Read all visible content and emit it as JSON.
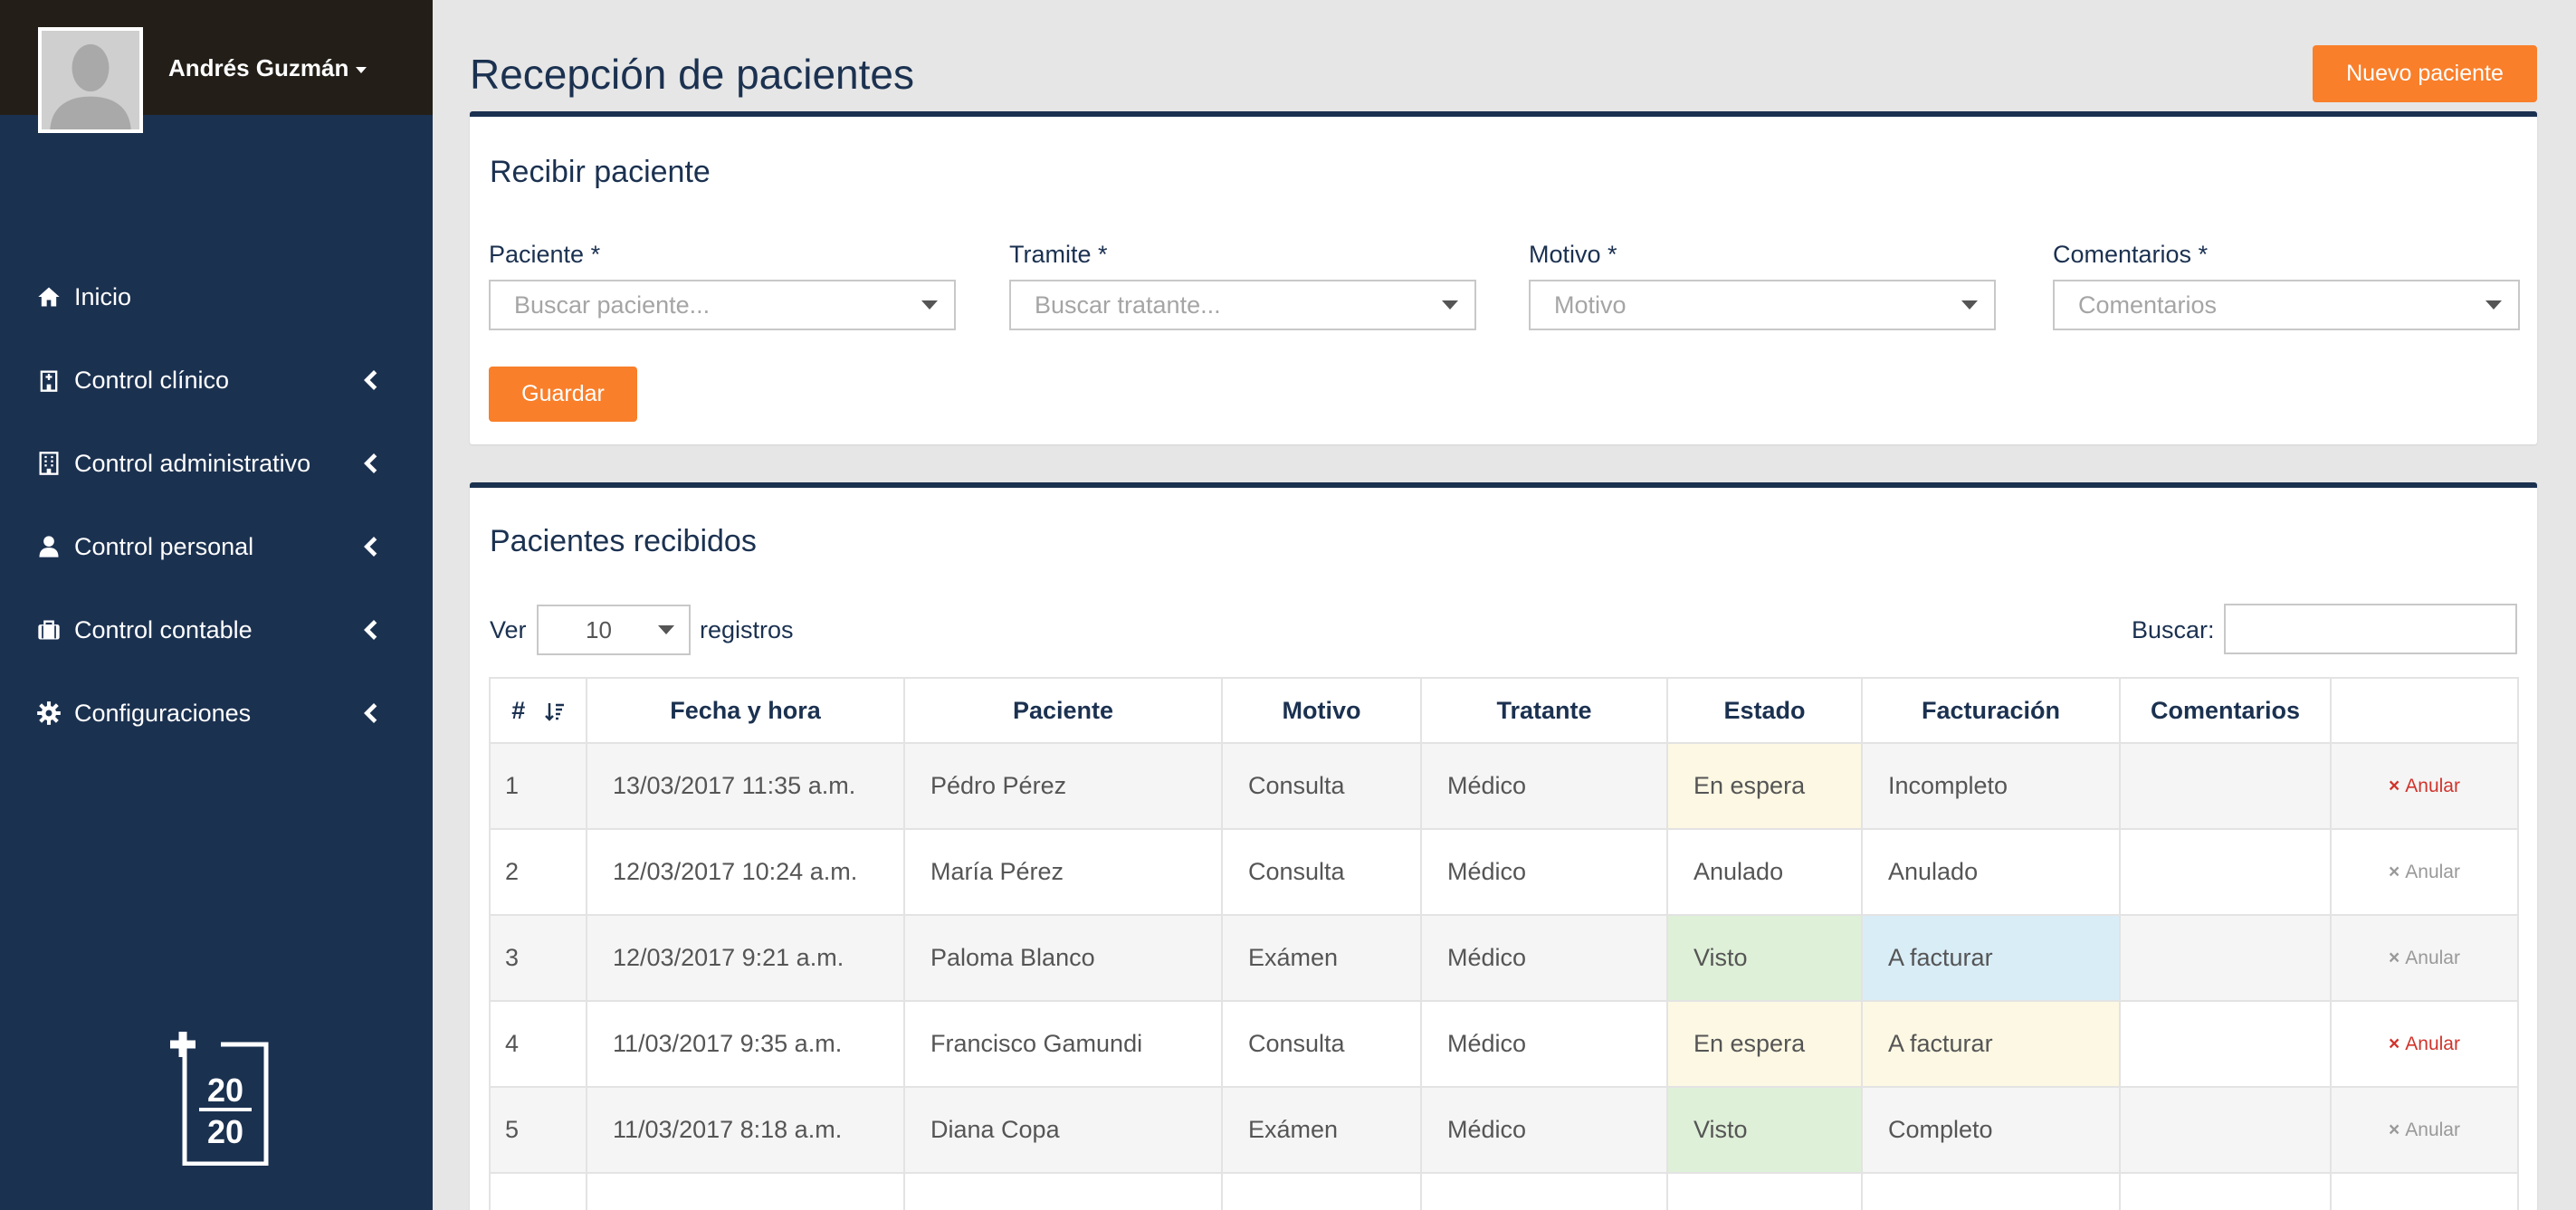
{
  "user": {
    "name": "Andrés Guzmán"
  },
  "sidebar": {
    "items": [
      {
        "label": "Inicio",
        "icon": "home-icon"
      },
      {
        "label": "Control clínico",
        "icon": "hospital-icon"
      },
      {
        "label": "Control administrativo",
        "icon": "building-icon"
      },
      {
        "label": "Control personal",
        "icon": "user-icon"
      },
      {
        "label": "Control contable",
        "icon": "briefcase-icon"
      },
      {
        "label": "Configuraciones",
        "icon": "gear-icon"
      }
    ],
    "logo_top": "20",
    "logo_bottom": "20"
  },
  "page": {
    "title": "Recepción de pacientes",
    "new_patient_button": "Nuevo paciente"
  },
  "form": {
    "title": "Recibir paciente",
    "fields": [
      {
        "label": "Paciente *",
        "placeholder": "Buscar paciente..."
      },
      {
        "label": "Tramite *",
        "placeholder": "Buscar tratante..."
      },
      {
        "label": "Motivo *",
        "placeholder": "Motivo"
      },
      {
        "label": "Comentarios *",
        "placeholder": "Comentarios"
      }
    ],
    "save_button": "Guardar"
  },
  "list": {
    "title": "Pacientes recibidos",
    "show_label": "Ver",
    "page_size": "10",
    "records_label": "registros",
    "search_label": "Buscar:",
    "search_value": "",
    "columns": [
      "#",
      "Fecha y hora",
      "Paciente",
      "Motivo",
      "Tratante",
      "Estado",
      "Facturación",
      "Comentarios",
      ""
    ],
    "rows": [
      {
        "num": "1",
        "datetime": "13/03/2017  11:35 a.m.",
        "patient": "Pédro Pérez",
        "reason": "Consulta",
        "doctor": "Médico",
        "status": "En espera",
        "billing": "Incompleto",
        "comments": "",
        "action": "Anular"
      },
      {
        "num": "2",
        "datetime": "12/03/2017  10:24 a.m.",
        "patient": "María Pérez",
        "reason": "Consulta",
        "doctor": "Médico",
        "status": "Anulado",
        "billing": "Anulado",
        "comments": "",
        "action": "Anular"
      },
      {
        "num": "3",
        "datetime": "12/03/2017  9:21 a.m.",
        "patient": "Paloma Blanco",
        "reason": "Exámen",
        "doctor": "Médico",
        "status": "Visto",
        "billing": "A facturar",
        "comments": "",
        "action": "Anular"
      },
      {
        "num": "4",
        "datetime": "11/03/2017  9:35 a.m.",
        "patient": "Francisco Gamundi",
        "reason": "Consulta",
        "doctor": "Médico",
        "status": "En espera",
        "billing": "A facturar",
        "comments": "",
        "action": "Anular"
      },
      {
        "num": "5",
        "datetime": "11/03/2017 8:18 a.m.",
        "patient": "Diana Copa",
        "reason": "Exámen",
        "doctor": "Médico",
        "status": "Visto",
        "billing": "Completo",
        "comments": "",
        "action": "Anular"
      }
    ]
  },
  "colors": {
    "sidebar": "#1b3150",
    "accent": "#f97f2a",
    "waiting": "#fcf8e3",
    "seen": "#dff0d8",
    "to_bill": "#d9edf7",
    "danger": "#d0342c"
  }
}
